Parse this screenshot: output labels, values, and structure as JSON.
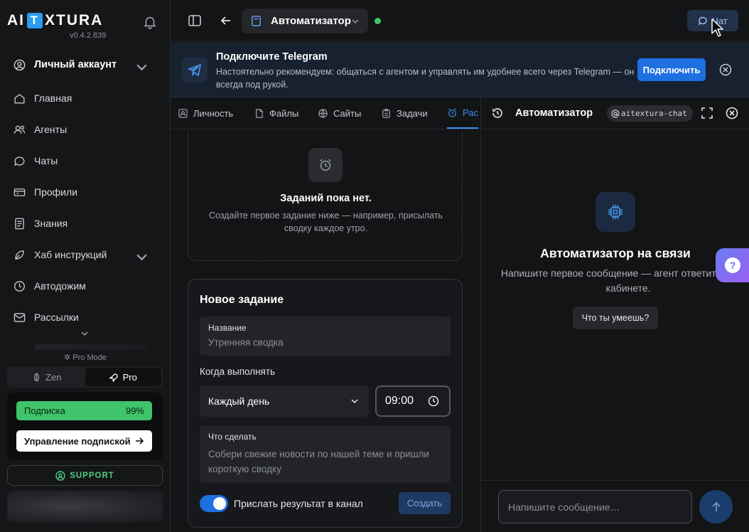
{
  "sidebar": {
    "logo_left": "AI",
    "logo_mid": "T",
    "logo_right": "XTURA",
    "version": "v0.4.2.839",
    "account_label": "Личный аккаунт",
    "items": [
      {
        "label": "Главная",
        "icon": "home-icon"
      },
      {
        "label": "Агенты",
        "icon": "users-icon"
      },
      {
        "label": "Чаты",
        "icon": "chat-icon"
      },
      {
        "label": "Профили",
        "icon": "card-icon"
      },
      {
        "label": "Знания",
        "icon": "book-icon"
      },
      {
        "label": "Хаб инструкций",
        "icon": "leaf-icon"
      },
      {
        "label": "Автодожим",
        "icon": "clock-icon"
      },
      {
        "label": "Рассылки",
        "icon": "mail-icon"
      }
    ],
    "pro_mode_label": "Pro Mode",
    "mode_zen": "Zen",
    "mode_pro": "Pro",
    "subscription_label": "Подписка",
    "subscription_percent": "99%",
    "manage_subscription": "Управление подпиской",
    "support_label": "SUPPORT"
  },
  "header": {
    "agent_name": "Автоматизатор",
    "chat_button": "Чат",
    "status_color": "#3fc46c"
  },
  "banner": {
    "title": "Подключите Telegram",
    "text": "Настоятельно рекомендуем: общаться с агентом и управлять им удобнее всего через Telegram — он всегда под рукой.",
    "connect_button": "Подключить"
  },
  "tabs": [
    {
      "label": "Личность"
    },
    {
      "label": "Файлы"
    },
    {
      "label": "Сайты"
    },
    {
      "label": "Задачи"
    },
    {
      "label": "Рас"
    }
  ],
  "empty_state": {
    "title": "Заданий пока нет.",
    "text": "Создайте первое задание ниже — например, присылать сводку каждое утро."
  },
  "new_task": {
    "title": "Новое задание",
    "name_label": "Название",
    "name_placeholder": "Утренняя сводка",
    "when_label": "Когда выполнять",
    "schedule_value": "Каждый день",
    "time_value": "09:00",
    "action_label": "Что сделать",
    "action_placeholder": "Собери свежие новости по нашей теме и пришли короткую сводку",
    "toggle_label": "Прислать результат в канал",
    "toggle_on": true,
    "create_button": "Создать"
  },
  "chat_panel": {
    "title": "Автоматизатор",
    "tag": "aitextura-chat",
    "welcome_title": "Автоматизатор на связи",
    "welcome_text": "Напишите первое сообщение — агент ответит здесь, в кабинете.",
    "suggestion": "Что ты умеешь?",
    "help_label": "?",
    "input_placeholder": "Напишите сообщение…"
  },
  "colors": {
    "accent": "#1e6fe0",
    "success": "#3fc46c",
    "background": "#131416"
  }
}
